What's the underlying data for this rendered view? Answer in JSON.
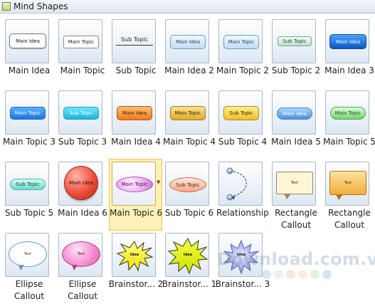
{
  "window": {
    "title": "Mind Shapes",
    "icon": "mind-shapes-icon"
  },
  "shapes": [
    {
      "label": "Main Idea",
      "thumb_text": "Main Idea",
      "style": "main-idea-white"
    },
    {
      "label": "Main Topic",
      "thumb_text": "Main Topic",
      "style": "main-topic-white"
    },
    {
      "label": "Sub Topic",
      "thumb_text": "Sub Topic",
      "style": "sub-topic-line"
    },
    {
      "label": "Main Idea 2",
      "thumb_text": "Main Idea",
      "style": "main-idea-blue"
    },
    {
      "label": "Main Topic 2",
      "thumb_text": "Main Topic",
      "style": "main-topic-blue"
    },
    {
      "label": "Sub Topic 2",
      "thumb_text": "Sub Topic",
      "style": "sub-topic-green"
    },
    {
      "label": "Main Idea 3",
      "thumb_text": "Main Idea",
      "style": "main-idea-strong-blue"
    },
    {
      "label": "Main Topic 3",
      "thumb_text": "Main Topic",
      "style": "main-topic-bright-blue"
    },
    {
      "label": "Sub Topic 3",
      "thumb_text": "Sub Topic",
      "style": "sub-topic-cyan"
    },
    {
      "label": "Main Idea 4",
      "thumb_text": "Main Idea",
      "style": "main-idea-orange"
    },
    {
      "label": "Main Topic 4",
      "thumb_text": "Main Topic",
      "style": "main-topic-gold"
    },
    {
      "label": "Sub Topic 4",
      "thumb_text": "Sub Topic",
      "style": "sub-topic-yellow"
    },
    {
      "label": "Main Idea 5",
      "thumb_text": "Main Idea",
      "style": "main-idea-blue-ellipse"
    },
    {
      "label": "Main Topic 5",
      "thumb_text": "Main Topic",
      "style": "main-topic-green"
    },
    {
      "label": "Sub Topic 5",
      "thumb_text": "Sub Topic",
      "style": "sub-topic-teal"
    },
    {
      "label": "Main Idea 6",
      "thumb_text": "Main Idea",
      "style": "main-idea-red-circle"
    },
    {
      "label": "Main Topic 6",
      "thumb_text": "Main Topic",
      "style": "main-topic-magenta-ellipse",
      "selected": true
    },
    {
      "label": "Sub Topic 6",
      "thumb_text": "Sub Topic",
      "style": "sub-topic-salmon-ellipse"
    },
    {
      "label": "Relationship",
      "thumb_text": "",
      "style": "relationship-arc"
    },
    {
      "label": "Rectangle Callout",
      "thumb_text": "Text",
      "style": "rectangle-callout-cream"
    },
    {
      "label": "Rectangle Callout",
      "thumb_text": "Text",
      "style": "rectangle-callout-orange"
    },
    {
      "label": "Ellipse Callout",
      "thumb_text": "Text",
      "style": "ellipse-callout-white"
    },
    {
      "label": "Ellipse Callout",
      "thumb_text": "Text",
      "style": "ellipse-callout-pink"
    },
    {
      "label": "Brainstor... 2",
      "thumb_text": "Idea",
      "style": "brainstorm-2"
    },
    {
      "label": "Brainstor... 1",
      "thumb_text": "Idea",
      "style": "brainstorm-1"
    },
    {
      "label": "Brainstor... 3",
      "thumb_text": "Idea",
      "style": "brainstorm-3"
    }
  ],
  "watermark": {
    "text": "Download.com.vn",
    "dot_colors": [
      "#9ea9c9",
      "#c8d4e6",
      "#e8b6a5",
      "#e6d18a",
      "#a6d2a6",
      "#8cb2d8"
    ]
  }
}
